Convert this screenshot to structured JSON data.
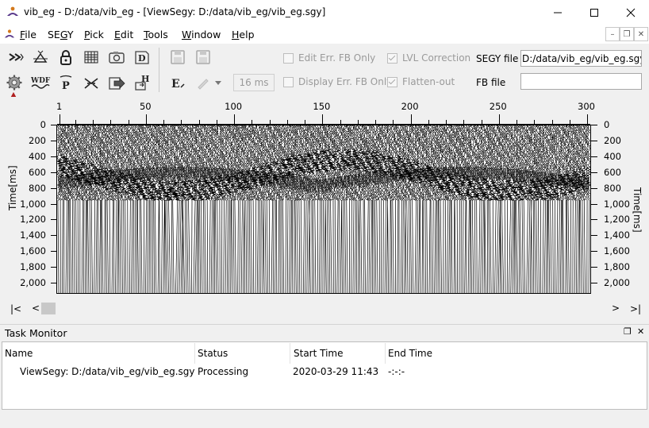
{
  "window": {
    "title": "vib_eg - D:/data/vib_eg - [ViewSegy: D:/data/vib_eg/vib_eg.sgy]",
    "icon": "app-logo-icon",
    "controls": [
      "minimize-icon",
      "maximize-icon",
      "close-icon"
    ]
  },
  "menubar": {
    "items": [
      {
        "label": "File",
        "underline": "F"
      },
      {
        "label": "SEGY",
        "underline": "G"
      },
      {
        "label": "Pick",
        "underline": "P"
      },
      {
        "label": "Edit",
        "underline": "E"
      },
      {
        "label": "Tools",
        "underline": "T"
      },
      {
        "label": "Window",
        "underline": "W"
      },
      {
        "label": "Help",
        "underline": "H"
      }
    ],
    "mdi_controls": [
      "mdi-minimize-icon",
      "mdi-restore-icon",
      "mdi-close-icon"
    ]
  },
  "toolbar": {
    "row1_icons": [
      "fast-forward-icon",
      "flip-triangle-icon",
      "lock-icon",
      "grid-table-icon",
      "camera-icon",
      "document-d-icon",
      "save-disabled-icon",
      "save-all-disabled-icon"
    ],
    "row2_icons": [
      "settings-gear-icon",
      "wdf-icon",
      "p-pick-icon",
      "scissors-icon",
      "export-arrow-icon",
      "h-header-icon",
      "e-edit-icon",
      "pen-disabled-icon",
      "dropdown-arrow-icon"
    ],
    "ms_value": "16 ms",
    "checkboxes": {
      "edit_err": {
        "label": "Edit Err. FB Only",
        "checked": false
      },
      "display_err": {
        "label": "Display Err. FB Only",
        "checked": false
      },
      "lvl": {
        "label": "LVL Correction",
        "checked": true
      },
      "flatten": {
        "label": "Flatten-out",
        "checked": true
      }
    },
    "segy_label": "SEGY file",
    "segy_value": "D:/data/vib_eg/vib_eg.sgy",
    "fb_label": "FB file",
    "fb_value": ""
  },
  "annotation": {
    "arrow_color": "#b01e1e",
    "points_to": "settings-gear-icon"
  },
  "plot": {
    "x_ticks": [
      "1",
      "50",
      "100",
      "150",
      "200",
      "250",
      "300"
    ],
    "y_ticks": [
      "0",
      "200",
      "400",
      "600",
      "800",
      "1,000",
      "1,200",
      "1,400",
      "1,600",
      "1,800",
      "2,000"
    ],
    "y_label_left": "Time[ms]",
    "y_label_right": "Time[ms]",
    "trace_count": 300
  },
  "scrollbar": {
    "first": "|<",
    "prev": "<",
    "next": ">",
    "last": ">|"
  },
  "task_monitor": {
    "title": "Task Monitor",
    "columns": [
      "Name",
      "Status",
      "Start Time",
      "End Time"
    ],
    "rows": [
      {
        "name": "ViewSegy: D:/data/vib_eg/vib_eg.sgy",
        "status": "Processing",
        "start": "2020-03-29 11:43",
        "end": "-:-:-"
      }
    ]
  }
}
